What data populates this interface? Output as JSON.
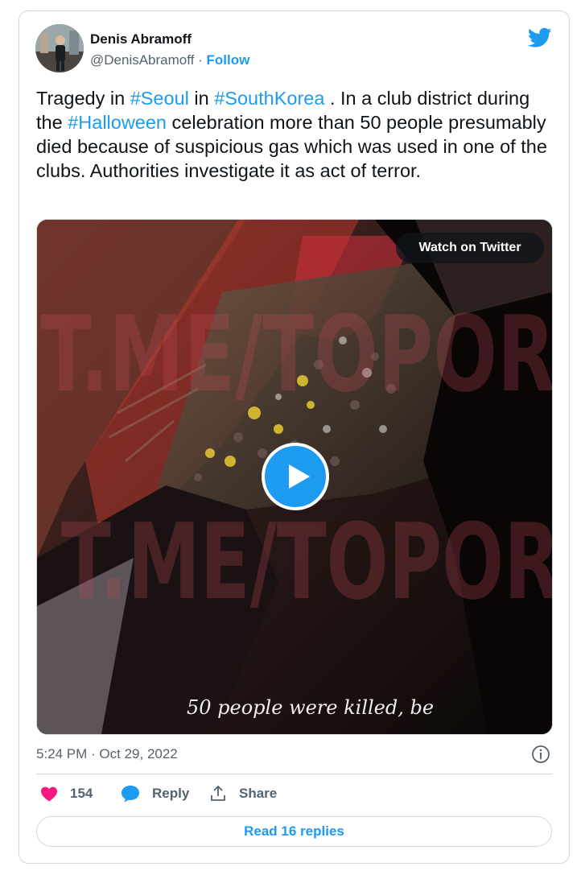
{
  "author": {
    "name": "Denis Abramoff",
    "handle": "@DenisAbramoff",
    "separator": "·",
    "follow_label": "Follow"
  },
  "tweet": {
    "segments": [
      {
        "text": "Tragedy in ",
        "type": "text"
      },
      {
        "text": "#Seoul",
        "type": "hashtag"
      },
      {
        "text": " in ",
        "type": "text"
      },
      {
        "text": "#SouthKorea",
        "type": "hashtag"
      },
      {
        "text": " . In a club district during the ",
        "type": "text"
      },
      {
        "text": "#Halloween",
        "type": "hashtag"
      },
      {
        "text": " celebration more than 50 people presumably died because of suspicious gas which was used in one of the clubs. Authorities investigate it as act of terror.",
        "type": "text"
      }
    ]
  },
  "media": {
    "watch_label": "Watch on Twitter",
    "watermark": "T.ME/TOPOR",
    "caption": "50 people were killed, be"
  },
  "timestamp": "5:24 PM · Oct 29, 2022",
  "actions": {
    "like_count": "154",
    "reply_label": "Reply",
    "share_label": "Share"
  },
  "read_replies_label": "Read 16 replies",
  "colors": {
    "accent": "#1d9bf0",
    "like": "#f91880",
    "secondary_text": "#536471",
    "border": "#cfd9de"
  },
  "icons": [
    "twitter-bird-icon",
    "play-icon",
    "info-icon",
    "heart-icon",
    "reply-bubble-icon",
    "share-icon"
  ]
}
